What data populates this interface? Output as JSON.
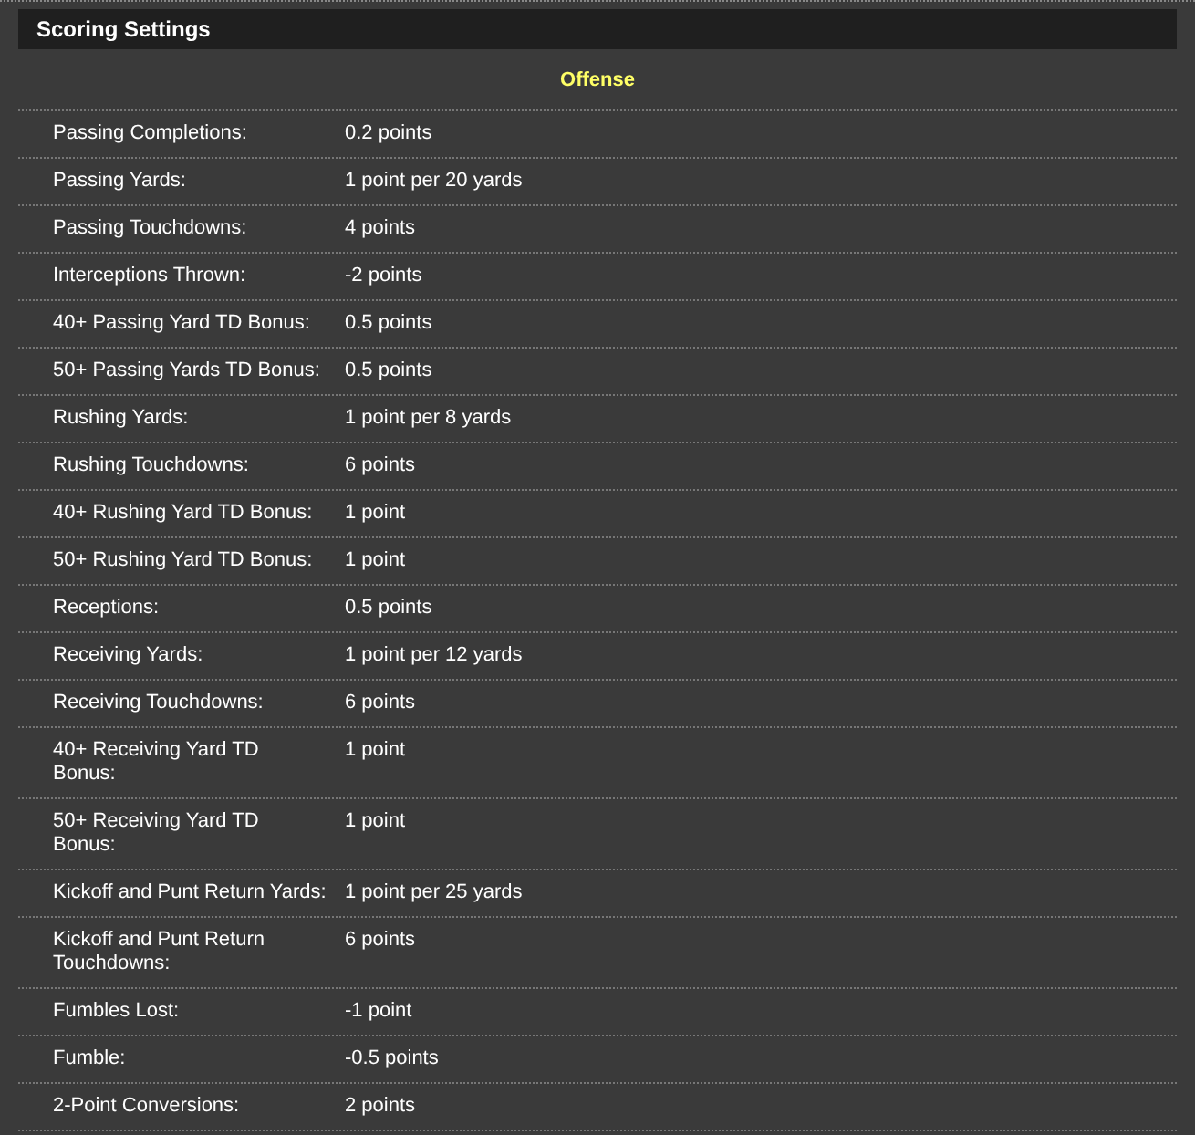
{
  "panel": {
    "title": "Scoring Settings"
  },
  "section": {
    "title": "Offense"
  },
  "rows": [
    {
      "label": "Passing Completions:",
      "value": "0.2 points"
    },
    {
      "label": "Passing Yards:",
      "value": "1 point per 20 yards"
    },
    {
      "label": "Passing Touchdowns:",
      "value": "4 points"
    },
    {
      "label": "Interceptions Thrown:",
      "value": "-2 points"
    },
    {
      "label": "40+ Passing Yard TD Bonus:",
      "value": "0.5 points"
    },
    {
      "label": "50+ Passing Yards TD Bonus:",
      "value": "0.5 points"
    },
    {
      "label": "Rushing Yards:",
      "value": "1 point per 8 yards"
    },
    {
      "label": "Rushing Touchdowns:",
      "value": "6 points"
    },
    {
      "label": "40+ Rushing Yard TD Bonus:",
      "value": "1 point"
    },
    {
      "label": "50+ Rushing Yard TD Bonus:",
      "value": "1 point"
    },
    {
      "label": "Receptions:",
      "value": "0.5 points"
    },
    {
      "label": "Receiving Yards:",
      "value": "1 point per 12 yards"
    },
    {
      "label": "Receiving Touchdowns:",
      "value": "6 points"
    },
    {
      "label": "40+ Receiving Yard TD Bonus:",
      "value": "1 point"
    },
    {
      "label": "50+ Receiving Yard TD Bonus:",
      "value": "1 point"
    },
    {
      "label": "Kickoff and Punt Return Yards:",
      "value": "1 point per 25 yards"
    },
    {
      "label": "Kickoff and Punt Return Touchdowns:",
      "value": "6 points"
    },
    {
      "label": "Fumbles Lost:",
      "value": "-1 point"
    },
    {
      "label": "Fumble:",
      "value": "-0.5 points"
    },
    {
      "label": "2-Point Conversions:",
      "value": "2 points"
    }
  ]
}
